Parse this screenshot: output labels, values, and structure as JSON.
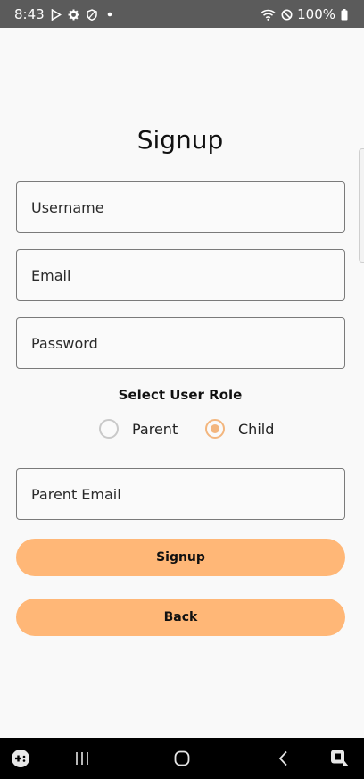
{
  "status_bar": {
    "time": "8:43",
    "battery": "100%",
    "icons_left": [
      "play-store-icon",
      "settings-icon",
      "shield-icon",
      "dot-icon"
    ],
    "icons_right": [
      "wifi-icon",
      "do-not-disturb-icon",
      "battery-icon"
    ]
  },
  "page": {
    "title": "Signup"
  },
  "form": {
    "username_placeholder": "Username",
    "email_placeholder": "Email",
    "password_placeholder": "Password",
    "role_label": "Select User Role",
    "roles": [
      {
        "label": "Parent",
        "selected": false
      },
      {
        "label": "Child",
        "selected": true
      }
    ],
    "parent_email_placeholder": "Parent Email"
  },
  "buttons": {
    "signup_label": "Signup",
    "back_label": "Back"
  },
  "colors": {
    "accent": "#ffb777",
    "radio_selected": "#f3b67e",
    "status_bar": "#5b5b5b",
    "nav_bar": "#000000",
    "background": "#f9f9f9"
  },
  "nav_bar": {
    "icons": [
      "game-launcher-icon",
      "recents-icon",
      "home-icon",
      "back-icon",
      "screenshot-icon"
    ]
  }
}
